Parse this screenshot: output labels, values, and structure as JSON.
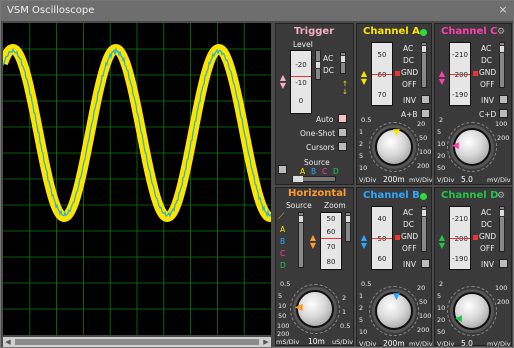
{
  "window": {
    "title": "VSM Oscilloscope",
    "close_glyph": "×"
  },
  "trigger": {
    "title": "Trigger",
    "level_label": "Level",
    "scale": [
      "-20",
      "-10",
      "0"
    ],
    "coupling": [
      "AC",
      "DC"
    ],
    "modes": [
      "Auto",
      "One-Shot",
      "Cursors"
    ],
    "source_label": "Source",
    "source_letters": [
      "A",
      "B",
      "C",
      "D"
    ]
  },
  "horizontal": {
    "title": "Horizontal",
    "source_label": "Source",
    "zoom_label": "Zoom",
    "source_letters": [
      "A",
      "B",
      "C",
      "D"
    ],
    "zoom_scale": [
      "50",
      "60",
      "70",
      "80"
    ],
    "knob_scale_left": [
      "0.5",
      "1",
      "2",
      "5",
      "10",
      "20",
      "50",
      "100",
      "200"
    ],
    "knob_scale_right": [
      "0.5",
      "1",
      "2",
      "5"
    ],
    "value": "10m",
    "unit_left": "mS/Div",
    "unit_right": "uS/Div"
  },
  "channels": [
    {
      "name": "Channel A",
      "color": "#ffe400",
      "scale": [
        "50",
        "60",
        "70"
      ],
      "coupling": [
        "AC",
        "DC",
        "GND",
        "OFF"
      ],
      "inv": "INV",
      "extra": "A+B",
      "value": "200m",
      "unit_left": "V/Div",
      "unit_right": "mV/Div"
    },
    {
      "name": "Channel C",
      "color": "#ff3fae",
      "scale": [
        "-210",
        "-200",
        "-190"
      ],
      "coupling": [
        "AC",
        "DC",
        "GND",
        "OFF"
      ],
      "inv": "INV",
      "extra": "C+D",
      "value": "5.0",
      "unit_left": "V/Div",
      "unit_right": "mV/Div"
    },
    {
      "name": "Channel B",
      "color": "#2ea8ff",
      "scale": [
        "40",
        "50",
        "60"
      ],
      "coupling": [
        "AC",
        "DC",
        "GND",
        "OFF"
      ],
      "inv": "INV",
      "extra": "",
      "value": "200m",
      "unit_left": "V/Div",
      "unit_right": "mV/Div"
    },
    {
      "name": "Channel D",
      "color": "#22c44a",
      "scale": [
        "-210",
        "-200",
        "-190"
      ],
      "coupling": [
        "AC",
        "DC",
        "GND",
        "OFF"
      ],
      "inv": "INV",
      "extra": "",
      "value": "5.0",
      "unit_left": "V/Div",
      "unit_right": "mV/Div"
    }
  ],
  "knob_scale_a": [
    "0.5",
    "1",
    "2",
    "5",
    "10",
    "20",
    "50",
    "100",
    "200"
  ],
  "knob_scale_b": [
    "2",
    "5",
    "10",
    "20",
    "50",
    "100",
    "200"
  ],
  "colors": {
    "grid": "#0b7a0b",
    "trace_a": "#ffe400",
    "trace_b": "#2bb5c8"
  },
  "chart_data": {
    "type": "line",
    "series": [
      {
        "values": [
          0,
          0.95,
          0.05,
          -0.95,
          0,
          0.95,
          0.05,
          -0.95,
          0
        ]
      },
      {
        "values": [
          0,
          0.9,
          0.05,
          -0.9,
          0,
          0.9,
          0.05,
          -0.9,
          0
        ]
      }
    ]
  }
}
